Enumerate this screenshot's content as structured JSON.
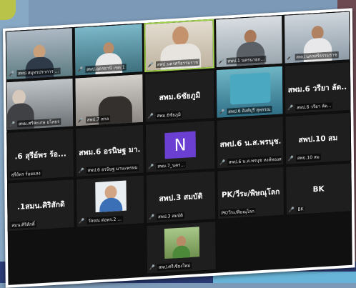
{
  "meeting": {
    "tiles": [
      {
        "id": "t1",
        "label": "สพป.สมุทรปราการ ...",
        "mic": "muted"
      },
      {
        "id": "t2",
        "label": "สพป.อุดรธานี เขต 1",
        "mic": "muted"
      },
      {
        "id": "t3",
        "label": "สพป.นครศรีธรรมราช",
        "mic": "muted",
        "active": true
      },
      {
        "id": "t4",
        "label": "สพป.1 นครนายก...",
        "mic": "muted"
      },
      {
        "id": "t5",
        "label": "สพป.นครศรีธรรมราช",
        "mic": "muted"
      },
      {
        "id": "t6",
        "label": "สพม.ศรีสะเกษ ยโสธร",
        "mic": "muted"
      },
      {
        "id": "t7",
        "label": "สพป.7 สกล",
        "mic": "muted"
      },
      {
        "id": "t8",
        "name": "สพม.6ชัยภูมิ",
        "label": "สพม.6ชัยภูมิ",
        "mic": "muted"
      },
      {
        "id": "t9",
        "label": "สพป.6 สิงห์บุรี สุพรรณ",
        "mic": "muted"
      },
      {
        "id": "t10",
        "name": "สพม.6 วรียา ลัด...",
        "label": "สพป.6 วรียา ลัด...",
        "mic": "muted"
      },
      {
        "id": "t11",
        "name": ".6 สุรีย์พร ร้อ...",
        "label": "สุรีย์พร ร้อยแลง",
        "mic": "muted"
      },
      {
        "id": "t12",
        "name": "สพม.6 อรนิษฐ มา...",
        "label": "สพป.6 อรนิษฐ มานะพรหม",
        "mic": "muted"
      },
      {
        "id": "t13",
        "initial": "N",
        "label": "สพม.7_นคร...",
        "mic": "muted"
      },
      {
        "id": "t14",
        "name": "สพป.6 น.ส.พรนุช...",
        "label": "สพป.6 น.ส.พรนุช หงส์ทองสมาน",
        "mic": "muted"
      },
      {
        "id": "t15",
        "name": "สพป.10 สม",
        "label": "สพป.10 สม",
        "mic": "muted"
      },
      {
        "id": "t16",
        "name": ".1สมน.ศิริสักดิ",
        "label": "สมน.ศิริสักดิ์",
        "mic": "muted"
      },
      {
        "id": "t17",
        "label": "วัลยณ ต่อพร.2 ...",
        "mic": "muted"
      },
      {
        "id": "t18",
        "name": "สพป.3 สมบัติ",
        "label": "สพป.3 สมบัติ",
        "mic": "muted"
      },
      {
        "id": "t19",
        "name": "PK/วีระ/พิษณุโลก",
        "label": "PK/วีระ/พิษณุโลก",
        "mic": "none"
      },
      {
        "id": "t20",
        "name": "BK",
        "label": "BK",
        "mic": "muted"
      },
      {
        "id": "t21",
        "label": "สพป.ศรีเชียงใหม่",
        "mic": "muted"
      }
    ]
  },
  "colors": {
    "tile": "#1e1e1e",
    "active_border": "#9fd24a",
    "muted_mic": "#e0383a",
    "avatar_N": "#6a3fd1"
  }
}
